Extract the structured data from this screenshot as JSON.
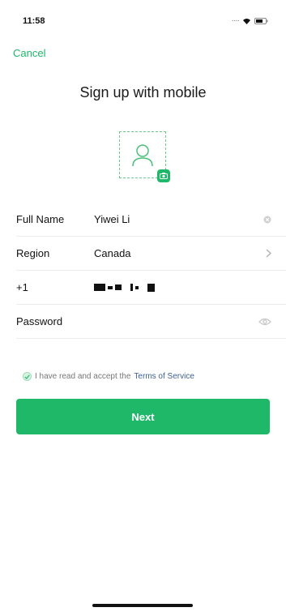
{
  "status_bar": {
    "time": "11:58",
    "icons": [
      "signal-dots-icon",
      "wifi-icon",
      "battery-icon"
    ]
  },
  "header": {
    "cancel_label": "Cancel"
  },
  "page": {
    "title": "Sign up with mobile"
  },
  "avatar": {
    "icon": "person-placeholder-icon",
    "badge_icon": "camera-icon"
  },
  "form": {
    "full_name": {
      "label": "Full Name",
      "value": "Yiwei Li",
      "trailing_icon": "clear-icon"
    },
    "region": {
      "label": "Region",
      "value": "Canada",
      "trailing_icon": "chevron-right-icon"
    },
    "phone": {
      "country_code": "+1",
      "value_redacted": true
    },
    "password": {
      "label": "Password",
      "value": "",
      "trailing_icon": "eye-icon"
    }
  },
  "terms": {
    "checked": true,
    "text": "I have read and accept the",
    "link_text": "Terms of Service"
  },
  "actions": {
    "next_label": "Next"
  },
  "colors": {
    "accent": "#1fb869",
    "link": "#3d5f93"
  }
}
